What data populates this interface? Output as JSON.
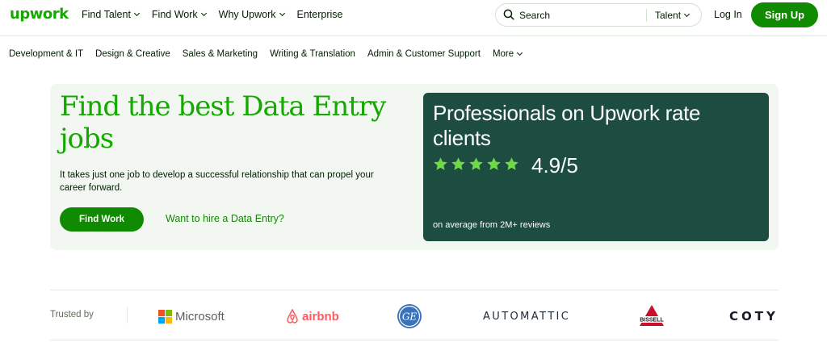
{
  "header": {
    "logo": "upwork",
    "nav": [
      {
        "label": "Find Talent"
      },
      {
        "label": "Find Work"
      },
      {
        "label": "Why Upwork"
      },
      {
        "label": "Enterprise"
      }
    ],
    "search": {
      "placeholder": "Search",
      "scope": "Talent"
    },
    "login": "Log In",
    "signup": "Sign Up"
  },
  "categories": [
    {
      "label": "Development & IT"
    },
    {
      "label": "Design & Creative"
    },
    {
      "label": "Sales & Marketing"
    },
    {
      "label": "Writing & Translation"
    },
    {
      "label": "Admin & Customer Support"
    },
    {
      "label": "More"
    }
  ],
  "hero": {
    "title": "Find the best Data Entry jobs",
    "subtitle": "It takes just one job to develop a successful relationship that can propel your career forward.",
    "primary_button": "Find Work",
    "secondary_link": "Want to hire a Data Entry?",
    "rating_card": {
      "title": "Professionals on Upwork rate clients",
      "stars": 5,
      "rating": "4.9/5",
      "note": "on average from 2M+ reviews"
    }
  },
  "trusted": {
    "label": "Trusted by",
    "brands": [
      {
        "name": "Microsoft"
      },
      {
        "name": "airbnb"
      },
      {
        "name": "GE"
      },
      {
        "name": "AUTOMATTIC"
      },
      {
        "name": "BISSELL"
      },
      {
        "name": "COTY"
      }
    ]
  },
  "colors": {
    "brand_green": "#14a800",
    "button_green": "#108a00",
    "card_dark": "#1d4d40",
    "star_green": "#6fda44",
    "hero_bg": "#f2f7f2"
  }
}
